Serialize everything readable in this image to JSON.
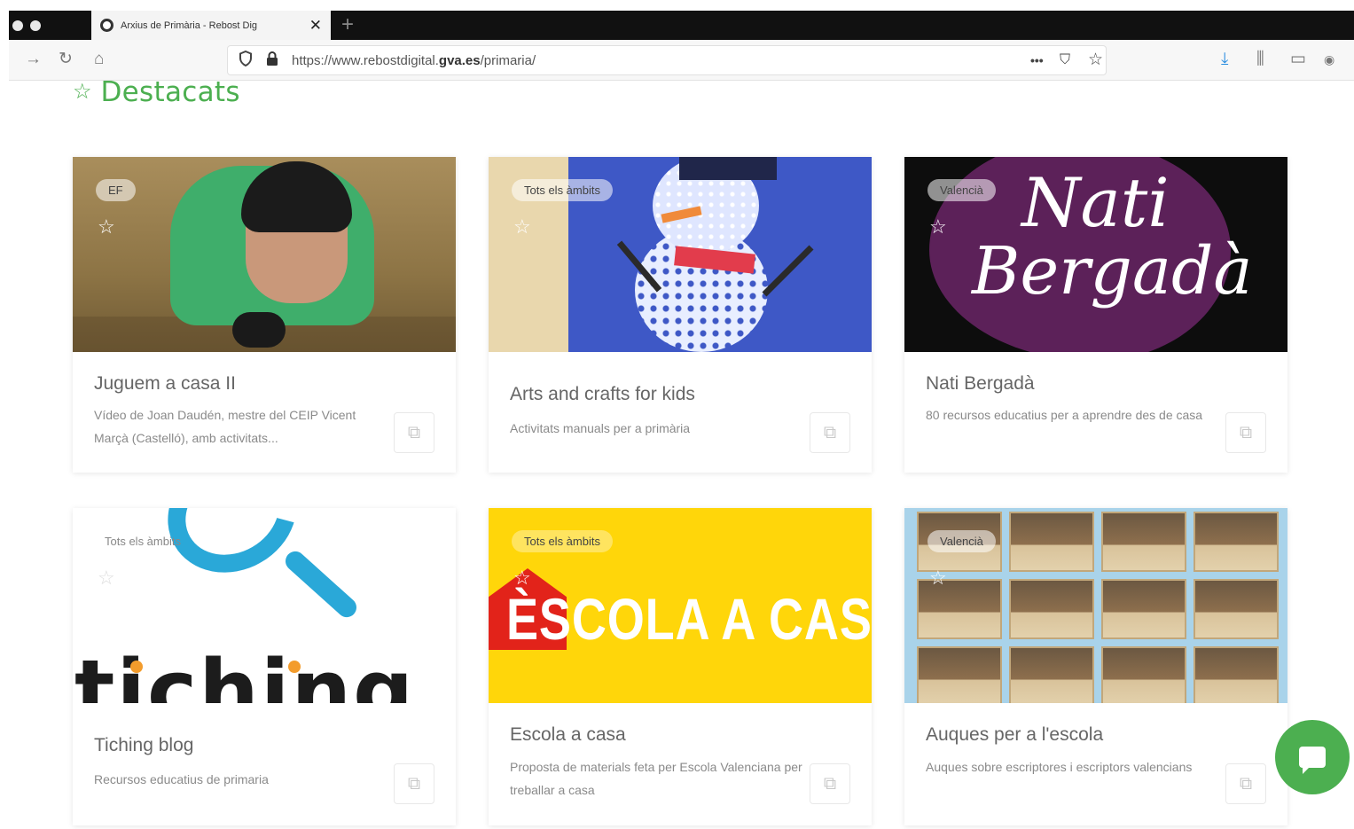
{
  "browser": {
    "tab_title": "Arxius de Primària - Rebost Dig",
    "tab_close": "✕",
    "new_tab": "+",
    "url_prefix": "https://www.rebostdigital.",
    "url_domain": "gva.es",
    "url_path": "/primaria/",
    "page_actions": "•••"
  },
  "section": {
    "title": "Destacats",
    "star": "☆"
  },
  "cards": [
    {
      "badge": "EF",
      "title": "Juguem a casa II",
      "desc": "Vídeo de Joan Daudén, mestre del CEIP Vicent Marçà (Castelló), amb activitats..."
    },
    {
      "badge": "Tots els àmbits",
      "title": "Arts and crafts for kids",
      "desc": "Activitats manuals per a primària"
    },
    {
      "badge": "Valencià",
      "title": "Nati Bergadà",
      "desc": "80 recursos educatius per a aprendre des de casa",
      "art_line1": "Nati",
      "art_line2": "Bergadà"
    },
    {
      "badge": "Tots els àmbits",
      "title": "Tiching blog",
      "desc": "Recursos educatius de primaria",
      "art_text": "tiching"
    },
    {
      "badge": "Tots els àmbits",
      "title": "Escola a casa",
      "desc": "Proposta de materials feta per Escola Valenciana per treballar a casa",
      "art_text": "ÈSCOLA A CASA"
    },
    {
      "badge": "Valencià",
      "title": "Auques per a l'escola",
      "desc": "Auques sobre escriptores i escriptors valencians"
    }
  ],
  "icons": {
    "favorite": "☆",
    "open_link": "⧉",
    "back": "→",
    "reload": "↻",
    "home": "⌂",
    "bookmark": "☆",
    "pocket": "⛉",
    "download": "⤓",
    "library": "⫼",
    "sidebar": "▭",
    "extension": "◉"
  },
  "colors": {
    "accent_green": "#4caf50",
    "plum": "#5c2159",
    "escola_yellow": "#ffd60a",
    "tiching_blue": "#2aa8d8"
  }
}
